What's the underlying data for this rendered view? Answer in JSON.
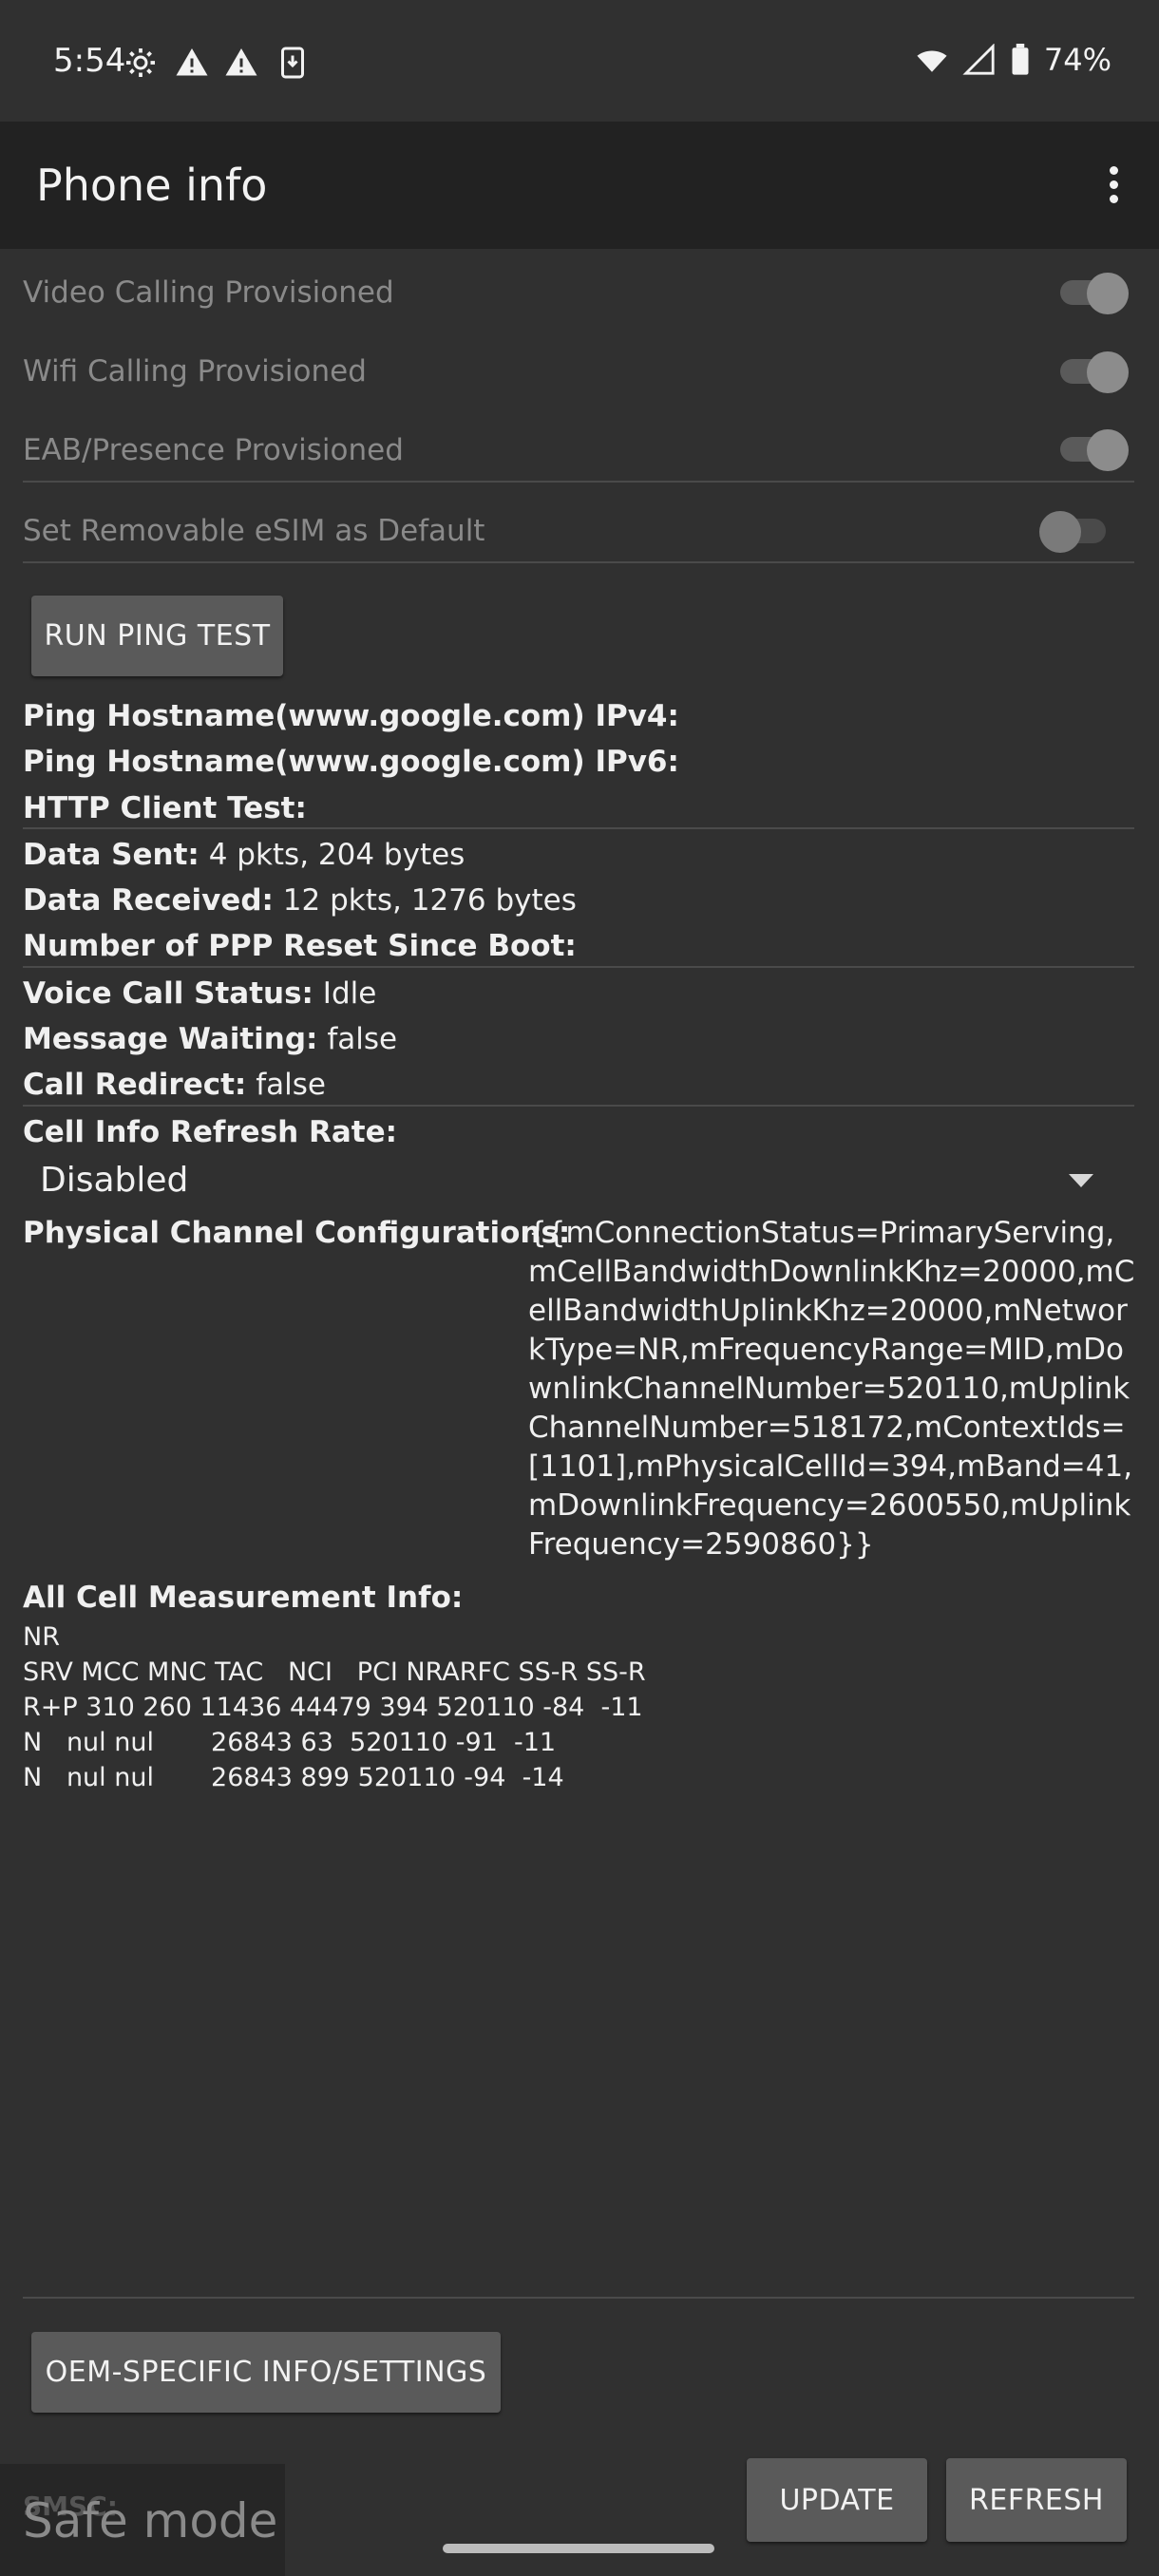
{
  "status_bar": {
    "time": "5:54",
    "battery": "74%",
    "icons": [
      "gear-icon",
      "warning-icon",
      "warning-icon",
      "download-icon",
      "wifi-icon",
      "signal-icon",
      "battery-icon"
    ]
  },
  "app_bar": {
    "title": "Phone info",
    "menu_icon": "more-vert-icon"
  },
  "toggles": [
    {
      "label": "Video Calling Provisioned",
      "on": true
    },
    {
      "label": "Wifi Calling Provisioned",
      "on": true
    },
    {
      "label": "EAB/Presence Provisioned",
      "on": true
    },
    {
      "label": "Set Removable eSIM as Default",
      "on": false
    }
  ],
  "buttons": {
    "run_ping_test": "RUN PING TEST",
    "oem_specific": "OEM-SPECIFIC INFO/SETTINGS",
    "update": "UPDATE",
    "refresh": "REFRESH"
  },
  "info": {
    "ping_ipv4_label": "Ping Hostname(www.google.com) IPv4:",
    "ping_ipv6_label": "Ping Hostname(www.google.com) IPv6:",
    "http_client_label": "HTTP Client Test:",
    "data_sent_label": "Data Sent:",
    "data_sent_value": "4 pkts, 204 bytes",
    "data_received_label": "Data Received:",
    "data_received_value": "12 pkts, 1276 bytes",
    "ppp_reset_label": "Number of PPP Reset Since Boot:",
    "voice_call_label": "Voice Call Status:",
    "voice_call_value": "Idle",
    "message_waiting_label": "Message Waiting:",
    "message_waiting_value": "false",
    "call_redirect_label": "Call Redirect:",
    "call_redirect_value": "false",
    "cell_refresh_label": "Cell Info Refresh Rate:",
    "cell_refresh_value": "Disabled",
    "pcc_label": "Physical Channel Configurations:",
    "pcc_value": "{{mConnectionStatus=PrimaryServing,mCellBandwidthDownlinkKhz=20000,mCellBandwidthUplinkKhz=20000,mNetworkType=NR,mFrequencyRange=MID,mDownlinkChannelNumber=520110,mUplinkChannelNumber=518172,mContextIds=[1101],mPhysicalCellId=394,mBand=41,mDownlinkFrequency=2600550,mUplinkFrequency=2590860}}",
    "meas_label": "All Cell Measurement Info:",
    "meas_lines": [
      "NR",
      "SRV MCC MNC TAC   NCI   PCI NRARFC SS-R SS-R",
      "R+P 310 260 11436 44479 394 520110 -84  -11",
      "N   nul nul       26843 63  520110 -91  -11",
      "N   nul nul       26843 899 520110 -94  -14"
    ],
    "smsc_label": "SMSC:"
  },
  "overlay": {
    "safe_mode": "Safe mode"
  }
}
